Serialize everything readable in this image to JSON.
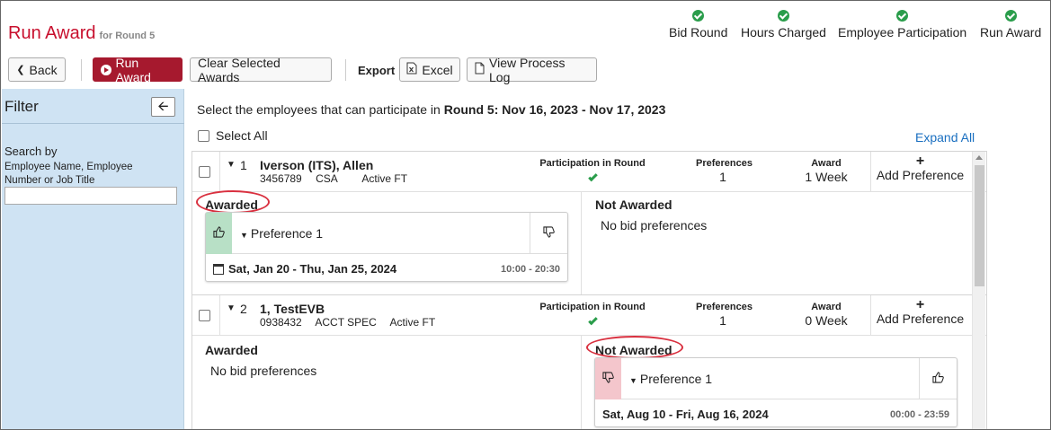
{
  "header": {
    "title": "Run Award",
    "subtitle": "for Round 5",
    "steps": [
      {
        "label": "Bid Round"
      },
      {
        "label": "Hours Charged"
      },
      {
        "label": "Employee Participation"
      },
      {
        "label": "Run Award"
      }
    ]
  },
  "toolbar": {
    "back": "Back",
    "run_award": "Run Award",
    "clear": "Clear Selected Awards",
    "export_label": "Export",
    "excel": "Excel",
    "view_log": "View Process Log"
  },
  "filter": {
    "title": "Filter",
    "search_label": "Search by",
    "search_hint": "Employee Name, Employee Number or Job Title",
    "search_value": ""
  },
  "main": {
    "intro_text": "Select the employees that can participate in ",
    "intro_round": "Round 5: Nov 16, 2023 - Nov 17, 2023",
    "select_all": "Select All",
    "expand_all": "Expand All",
    "col_participation": "Participation in Round",
    "col_preferences": "Preferences",
    "col_award": "Award",
    "add_preference": "Add Preference",
    "awarded_title": "Awarded",
    "not_awarded_title": "Not Awarded",
    "no_prefs": "No bid preferences",
    "employees": [
      {
        "num": "1",
        "name": "Iverson (ITS), Allen",
        "id": "3456789",
        "job": "CSA",
        "status": "Active FT",
        "preferences": "1",
        "award": "1 Week",
        "pref_name": "Preference 1",
        "pref_dates": "Sat, Jan 20 - Thu, Jan 25, 2024",
        "pref_time": "10:00 - 20:30"
      },
      {
        "num": "2",
        "name": "1, TestEVB",
        "id": "0938432",
        "job": "ACCT SPEC",
        "status": "Active FT",
        "preferences": "1",
        "award": "0 Week",
        "pref_name": "Preference 1",
        "pref_dates": "Sat, Aug 10 - Fri, Aug 16, 2024",
        "pref_time": "00:00 - 23:59"
      }
    ]
  },
  "colors": {
    "accent_red": "#c8102e",
    "button_red": "#a6192e",
    "filter_bg": "#cfe3f3",
    "check_green": "#2a9d4b",
    "link_blue": "#1a6fc0",
    "highlight_ring": "#d9303f"
  }
}
